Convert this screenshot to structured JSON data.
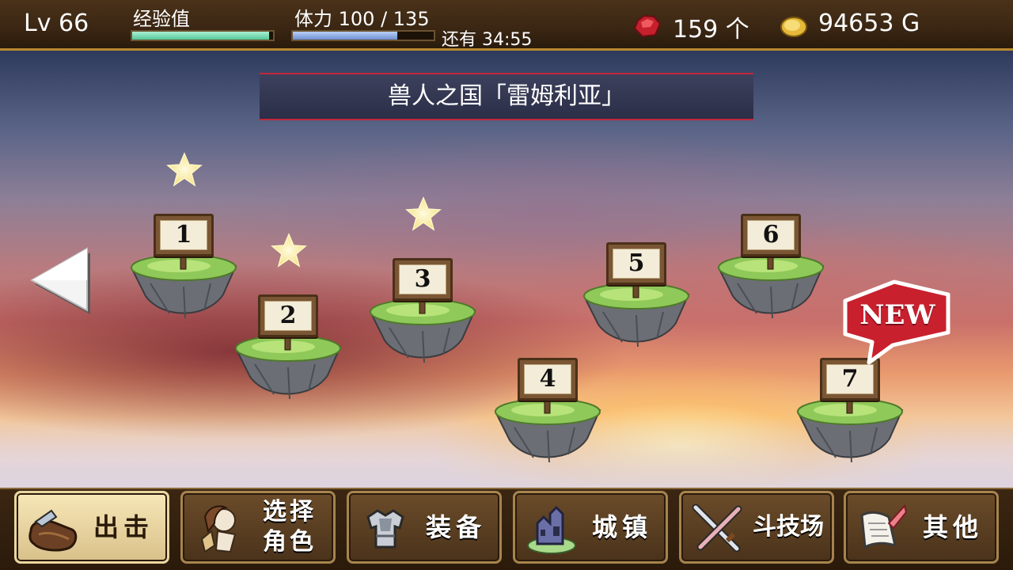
{
  "topbar": {
    "level": "Lv 66",
    "exp_label": "经验值",
    "exp_fraction": 0.97,
    "stamina_label": "体力 100 / 135",
    "stamina_fraction": 0.74,
    "timer": "还有 34:55",
    "gems": "159 个",
    "gold": "94653 G",
    "gem_icon": "red-gem-icon",
    "gold_icon": "gold-coin-icon"
  },
  "banner": {
    "title": "兽人之国「雷姆利亚」"
  },
  "stages": [
    {
      "number": "1",
      "starred": true
    },
    {
      "number": "2",
      "starred": true
    },
    {
      "number": "3",
      "starred": true
    },
    {
      "number": "4",
      "starred": false
    },
    {
      "number": "5",
      "starred": false
    },
    {
      "number": "6",
      "starred": false
    },
    {
      "number": "7",
      "starred": false,
      "badge": "NEW"
    }
  ],
  "menu": {
    "sortie": "出击",
    "select_character": "选择\n角色",
    "equipment": "装备",
    "town": "城镇",
    "arena": "斗技场",
    "other": "其他"
  },
  "colors": {
    "accent_red": "#c0273a",
    "wood_dark": "#3a2613",
    "gold_border": "#b8892e"
  }
}
